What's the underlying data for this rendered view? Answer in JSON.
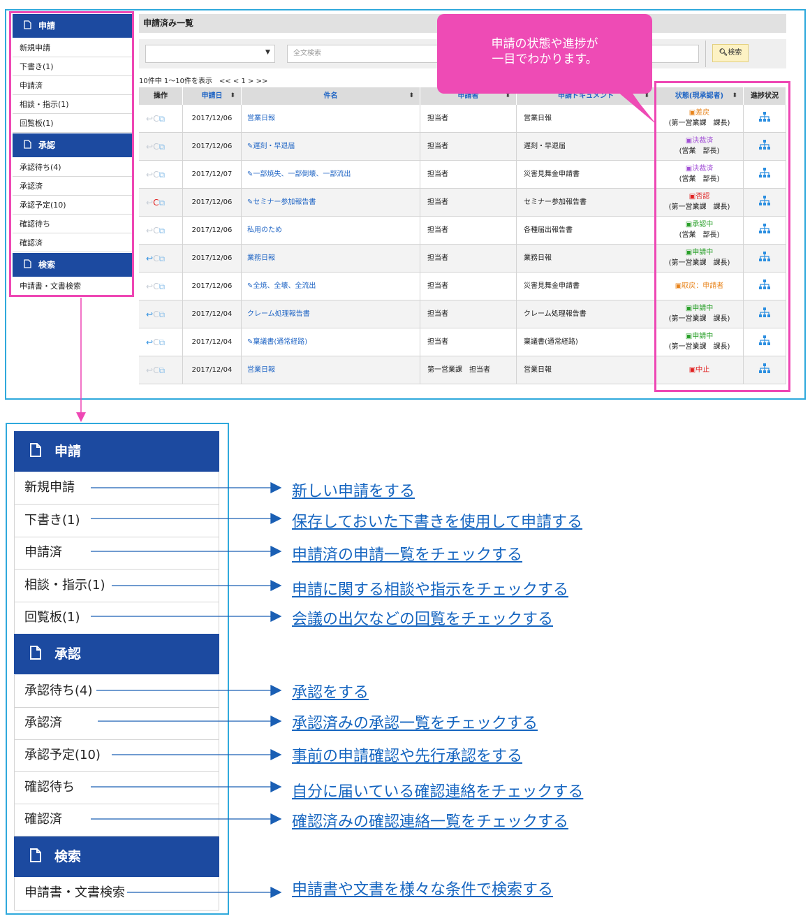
{
  "sidebar": {
    "sections": [
      {
        "label": "申請",
        "items": [
          "新規申請",
          "下書き(1)",
          "申請済",
          "相談・指示(1)",
          "回覧板(1)"
        ]
      },
      {
        "label": "承認",
        "items": [
          "承認待ち(4)",
          "承認済",
          "承認予定(10)",
          "確認待ち",
          "確認済"
        ]
      },
      {
        "label": "検索",
        "items": [
          "申請書・文書検索"
        ]
      }
    ]
  },
  "list": {
    "title": "申請済み一覧",
    "search_placeholder": "全文検索",
    "search_button": "検索",
    "paging": "10件中 1～10件を表示　<< < 1 > >>",
    "columns": [
      "操作",
      "申請日",
      "件名",
      "申請者",
      "申請ドキュメント",
      "状態(現承認者)",
      "進捗状況"
    ],
    "rows": [
      {
        "date": "2017/12/06",
        "subject": "営業日報",
        "applicant": "担当者",
        "document": "営業日報",
        "status": "差戻",
        "approver": "(第一営業課　課長)",
        "status_color": "#e8841c",
        "back": false,
        "redo": false
      },
      {
        "date": "2017/12/06",
        "subject": "✎遅刻・早退届",
        "applicant": "担当者",
        "document": "遅刻・早退届",
        "status": "決裁済",
        "approver": "(営業　部長)",
        "status_color": "#a352d6",
        "back": false,
        "redo": false
      },
      {
        "date": "2017/12/07",
        "subject": "✎一部焼失、一部倒壊、一部流出",
        "applicant": "担当者",
        "document": "災害見舞金申請書",
        "status": "決裁済",
        "approver": "(営業　部長)",
        "status_color": "#a352d6",
        "back": false,
        "redo": false
      },
      {
        "date": "2017/12/06",
        "subject": "✎セミナー参加報告書",
        "applicant": "担当者",
        "document": "セミナー参加報告書",
        "status": "否認",
        "approver": "(第一営業課　課長)",
        "status_color": "#e02020",
        "back": false,
        "redo": true
      },
      {
        "date": "2017/12/06",
        "subject": "私用のため",
        "applicant": "担当者",
        "document": "各種届出報告書",
        "status": "承認中",
        "approver": "(営業　部長)",
        "status_color": "#2aa02a",
        "back": false,
        "redo": false
      },
      {
        "date": "2017/12/06",
        "subject": "業務日報",
        "applicant": "担当者",
        "document": "業務日報",
        "status": "申請中",
        "approver": "(第一営業課　課長)",
        "status_color": "#2aa02a",
        "back": true,
        "redo": false
      },
      {
        "date": "2017/12/06",
        "subject": "✎全焼、全壊、全流出",
        "applicant": "担当者",
        "document": "災害見舞金申請書",
        "status": "取戻：申請者",
        "approver": "",
        "status_color": "#e8841c",
        "back": false,
        "redo": false
      },
      {
        "date": "2017/12/04",
        "subject": "クレーム処理報告書",
        "applicant": "担当者",
        "document": "クレーム処理報告書",
        "status": "申請中",
        "approver": "(第一営業課　課長)",
        "status_color": "#2aa02a",
        "back": true,
        "redo": false
      },
      {
        "date": "2017/12/04",
        "subject": "✎稟議書(通常経路)",
        "applicant": "担当者",
        "document": "稟議書(通常経路)",
        "status": "申請中",
        "approver": "(第一営業課　課長)",
        "status_color": "#2aa02a",
        "back": true,
        "redo": false
      },
      {
        "date": "2017/12/04",
        "subject": "営業日報",
        "applicant": "第一営業課　担当者",
        "document": "営業日報",
        "status": "中止",
        "approver": "",
        "status_color": "#e02020",
        "back": false,
        "redo": false
      }
    ]
  },
  "callout": {
    "line1": "申請の状態や進捗が",
    "line2": "一目でわかります。"
  },
  "descriptions": [
    "新しい申請をする",
    "保存しておいた下書きを使用して申請する",
    "申請済の申請一覧をチェックする",
    "申請に関する相談や指示をチェックする",
    "会議の出欠などの回覧をチェックする",
    "承認をする",
    "承認済みの承認一覧をチェックする",
    "事前の申請確認や先行承認をする",
    "自分に届いている確認連絡をチェックする",
    "確認済みの確認連絡一覧をチェックする",
    "申請書や文書を様々な条件で検索する"
  ],
  "colors": {
    "header_blue": "#1c4aa0",
    "frame_cyan": "#2fa9dc",
    "highlight_pink": "#ee47b4",
    "link_blue": "#2166c5"
  }
}
